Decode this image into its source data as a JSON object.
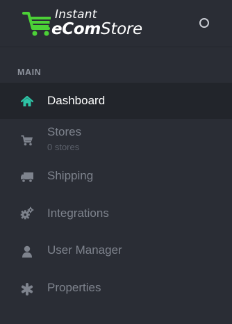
{
  "brand": {
    "line1": "Instant",
    "line2a": "eCom",
    "line2b": "Store"
  },
  "sidebar": {
    "section_label": "MAIN",
    "items": [
      {
        "label": "Dashboard",
        "icon": "home-icon",
        "active": true
      },
      {
        "label": "Stores",
        "sublabel": "0 stores",
        "icon": "cart-icon"
      },
      {
        "label": "Shipping",
        "icon": "truck-icon"
      },
      {
        "label": "Integrations",
        "icon": "cogs-icon"
      },
      {
        "label": "User Manager",
        "icon": "user-icon"
      },
      {
        "label": "Properties",
        "icon": "asterisk-icon"
      }
    ]
  },
  "colors": {
    "background": "#2a2d35",
    "active_background": "#22252b",
    "accent": "#2ec4a6",
    "logo_green": "#4cd137",
    "inactive_text": "#7e838d"
  }
}
